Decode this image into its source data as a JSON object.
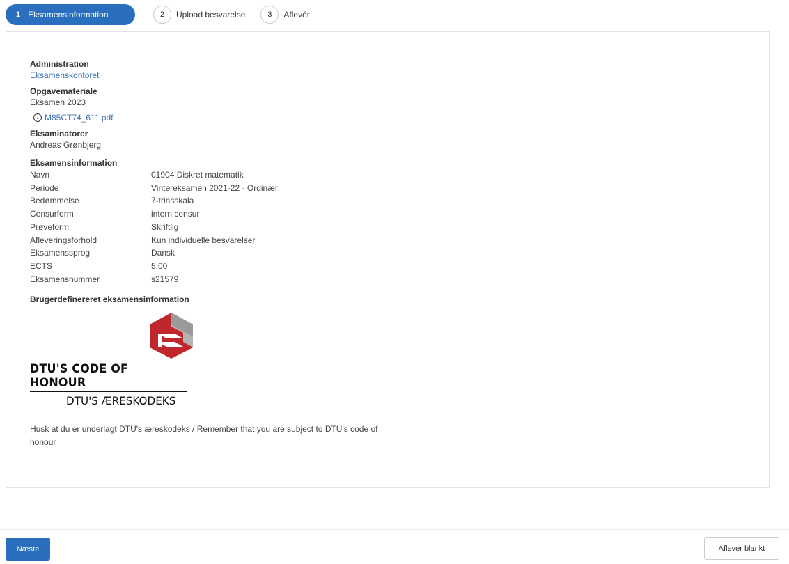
{
  "steps": [
    {
      "num": "1",
      "label": "Eksamensinformation",
      "active": true
    },
    {
      "num": "2",
      "label": "Upload besvarelse",
      "active": false
    },
    {
      "num": "3",
      "label": "Aflevér",
      "active": false
    }
  ],
  "administration": {
    "heading": "Administration",
    "link": "Eksamenskontoret"
  },
  "material": {
    "heading": "Opgavemateriale",
    "name": "Eksamen 2023",
    "file_icon": "download-icon",
    "file": "M85CT74_611.pdf"
  },
  "examiners": {
    "heading": "Eksaminatorer",
    "names": "Andreas Grønbjerg"
  },
  "exam_info": {
    "heading": "Eksamensinformation",
    "rows": [
      {
        "key": "Navn",
        "value": "01904 Diskret matematik"
      },
      {
        "key": "Periode",
        "value": "Vintereksamen 2021-22 - Ordinær"
      },
      {
        "key": "Bedømmelse",
        "value": "7-trinsskala"
      },
      {
        "key": "Censurform",
        "value": "intern censur"
      },
      {
        "key": "Prøveform",
        "value": "Skriftlig"
      },
      {
        "key": "Afleveringsforhold",
        "value": "Kun individuelle besvarelser"
      },
      {
        "key": "Eksamenssprog",
        "value": "Dansk"
      },
      {
        "key": "ECTS",
        "value": "5,00"
      },
      {
        "key": "Eksamensnummer",
        "value": "s21579"
      }
    ]
  },
  "custom": {
    "heading": "Brugerdefinereret eksamensinformation",
    "logo_title": "DTU'S CODE OF HONOUR",
    "logo_subtitle": "DTU'S ÆRESKODEKS",
    "reminder": "Husk at du er underlagt DTU's æreskodeks / Remember that you are subject to DTU's code of honour"
  },
  "footer": {
    "next_label": "Næste",
    "blank_label": "Aflever blankt"
  },
  "colors": {
    "primary": "#2a6fbd",
    "link": "#3b74b5",
    "logo_red": "#c0272d",
    "logo_gray": "#9a9a9a"
  }
}
